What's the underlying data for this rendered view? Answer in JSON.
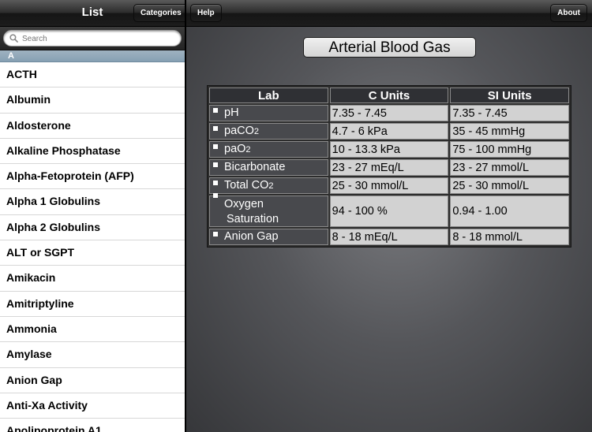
{
  "sidebar": {
    "title": "List",
    "categories_label": "Categories",
    "search_placeholder": "Search",
    "section_letter": "A",
    "items": [
      "ACTH",
      "Albumin",
      "Aldosterone",
      "Alkaline Phosphatase",
      "Alpha-Fetoprotein (AFP)",
      "Alpha 1 Globulins",
      "Alpha 2 Globulins",
      "ALT or SGPT",
      "Amikacin",
      "Amitriptyline",
      "Ammonia",
      "Amylase",
      "Anion Gap",
      "Anti-Xa Activity",
      "Apolipoprotein A1"
    ]
  },
  "toolbar": {
    "help_label": "Help",
    "about_label": "About"
  },
  "detail": {
    "title": "Arterial Blood Gas",
    "headers": [
      "Lab",
      "C Units",
      "SI Units"
    ],
    "rows": [
      {
        "lab": "pH",
        "lab_sub": "",
        "lab_line2": "",
        "c": "7.35 - 7.45",
        "si": "7.35 - 7.45"
      },
      {
        "lab": "paCO",
        "lab_sub": "2",
        "lab_line2": "",
        "c": "4.7 - 6 kPa",
        "si": "35 - 45 mmHg"
      },
      {
        "lab": "paO",
        "lab_sub": "2",
        "lab_line2": "",
        "c": "10 - 13.3 kPa",
        "si": "75 - 100 mmHg"
      },
      {
        "lab": "Bicarbonate",
        "lab_sub": "",
        "lab_line2": "",
        "c": "23 - 27 mEq/L",
        "si": "23 - 27 mmol/L"
      },
      {
        "lab": "Total CO",
        "lab_sub": "2",
        "lab_line2": "",
        "c": "25 - 30 mmol/L",
        "si": "25 - 30 mmol/L"
      },
      {
        "lab": "Oxygen",
        "lab_sub": "",
        "lab_line2": "Saturation",
        "c": "94 - 100 %",
        "si": "0.94 - 1.00"
      },
      {
        "lab": "Anion Gap",
        "lab_sub": "",
        "lab_line2": "",
        "c": "8 - 18 mEq/L",
        "si": "8 - 18 mmol/L"
      }
    ]
  },
  "colors": {
    "section_header": "#93a9b9",
    "value_cell": "#d2d2d2",
    "label_cell": "#48494d"
  },
  "icons": {
    "search": "magnifier-icon",
    "bullet": "square-bullet-icon"
  }
}
